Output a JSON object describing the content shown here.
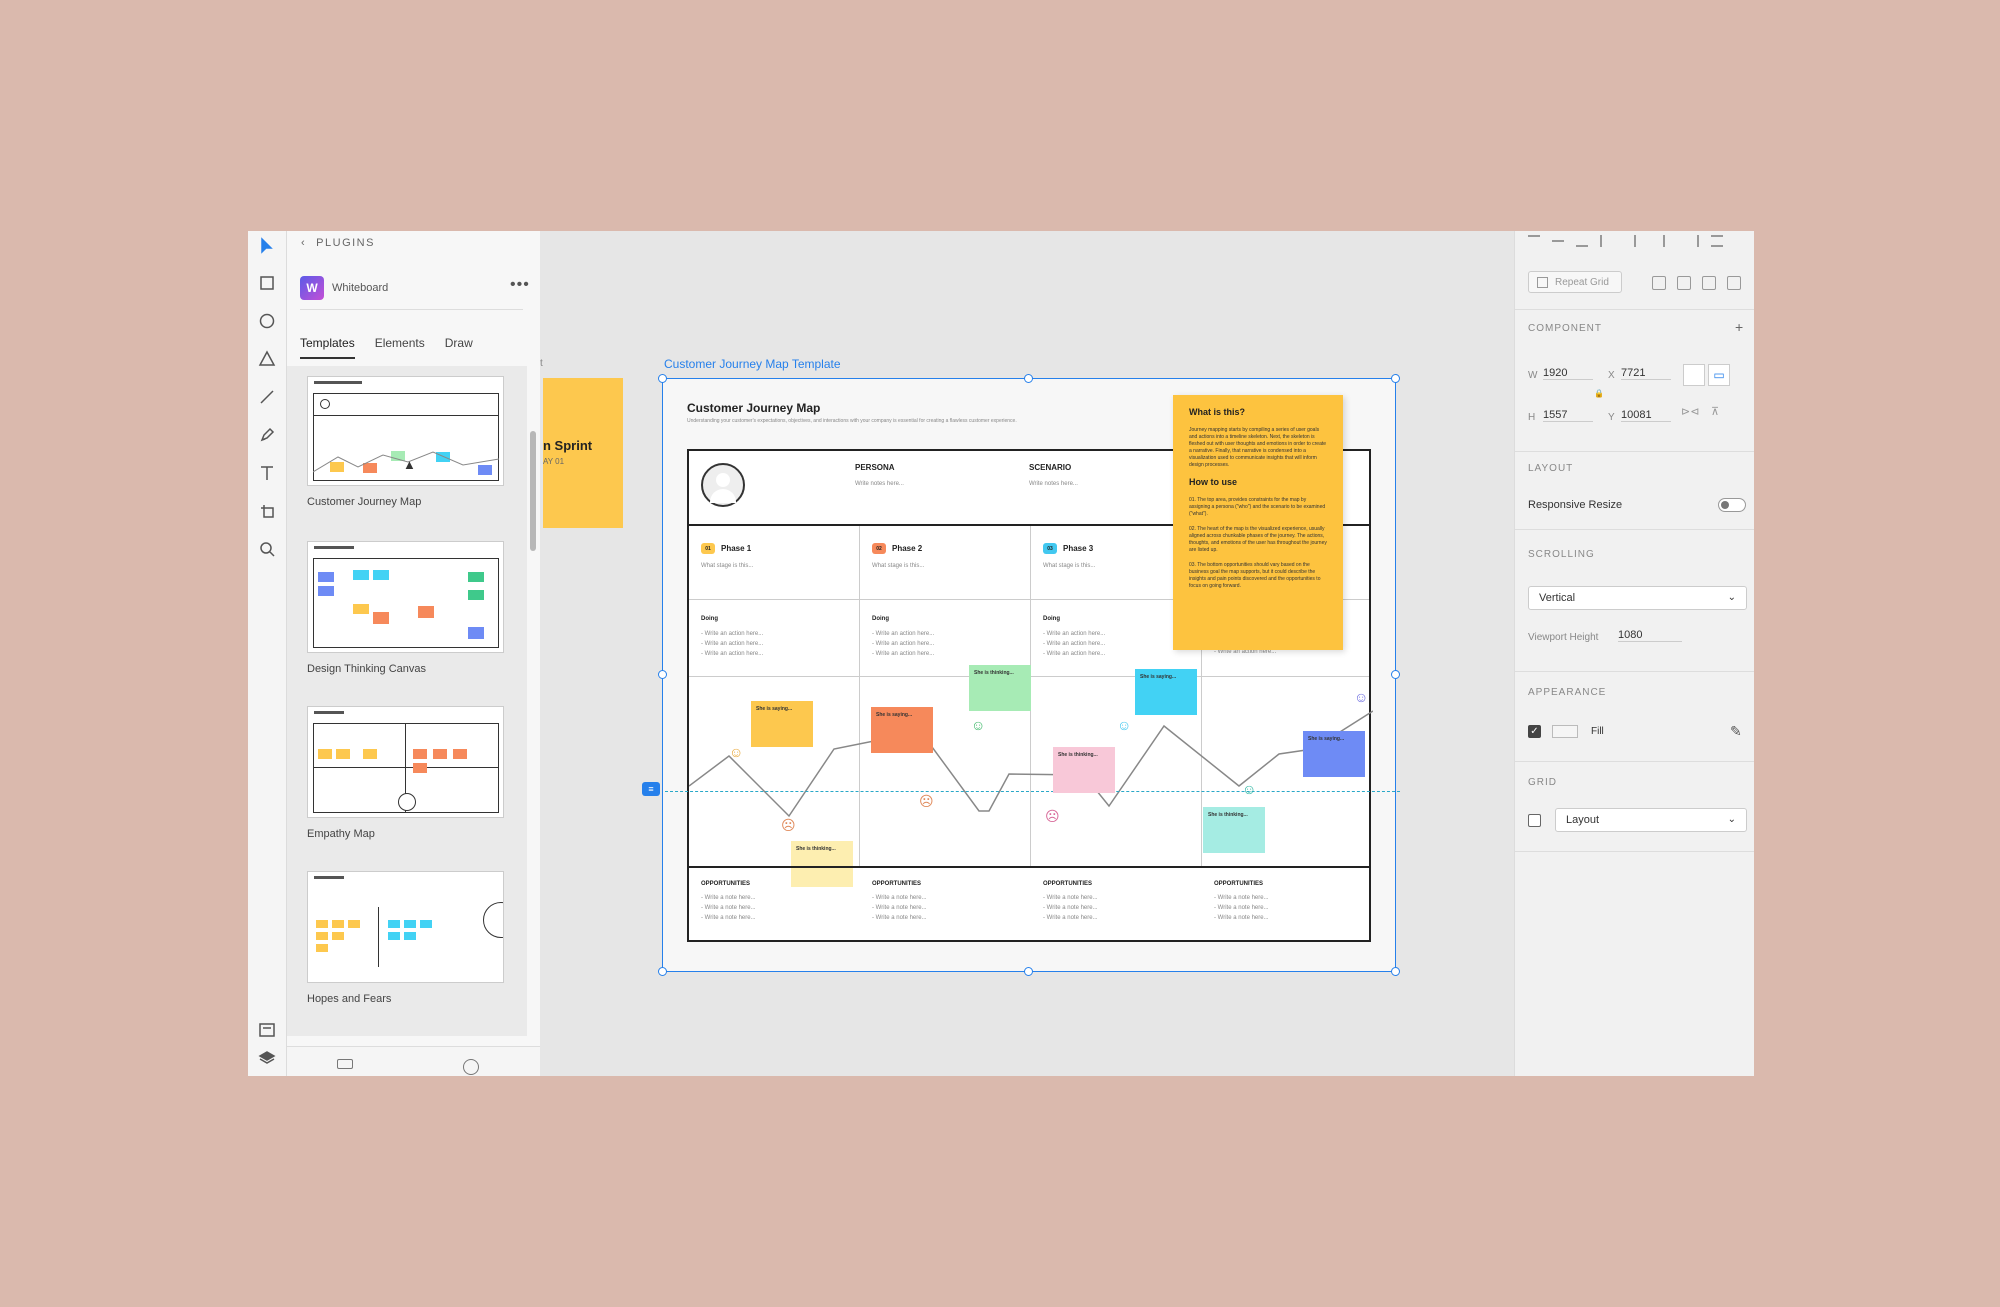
{
  "plugins": {
    "header": "PLUGINS",
    "plugin_name": "Whiteboard",
    "tabs": [
      "Templates",
      "Elements",
      "Draw"
    ],
    "templates": [
      "Customer Journey Map",
      "Design Thinking Canvas",
      "Empathy Map",
      "Hopes and Fears"
    ]
  },
  "canvas": {
    "artboard_label": "Customer Journey Map Template",
    "side_card_title": "n Sprint",
    "side_card_sub": "AY 01",
    "map": {
      "title": "Customer Journey Map",
      "subtitle": "Understanding your customer's expectations, objectives, and interactions with your company is essential for creating a flawless customer experience.",
      "persona_label": "PERSONA",
      "persona_note": "Write notes here...",
      "scenario_label": "SCENARIO",
      "scenario_note": "Write notes here...",
      "phases": [
        {
          "num": "01",
          "name": "Phase 1",
          "sub": "What stage is this...",
          "color": "#fdc84e"
        },
        {
          "num": "02",
          "name": "Phase 2",
          "sub": "What stage is this...",
          "color": "#f6895b"
        },
        {
          "num": "03",
          "name": "Phase 3",
          "sub": "What stage is this...",
          "color": "#42c8f0"
        }
      ],
      "doing_label": "Doing",
      "action_line": "- Write an action here...",
      "opportunities_label": "OPPORTUNITIES",
      "note_line": "- Write a note here...",
      "stickies": [
        {
          "text": "She is saying...",
          "color": "#fdc84e"
        },
        {
          "text": "She is thinking...",
          "color": "#fdeeb0"
        },
        {
          "text": "She is saying...",
          "color": "#f6895b"
        },
        {
          "text": "She is thinking...",
          "color": "#a7ebb5"
        },
        {
          "text": "She is thinking...",
          "color": "#f8c8d8"
        },
        {
          "text": "She is saying...",
          "color": "#42d2f4"
        },
        {
          "text": "She is thinking...",
          "color": "#a5ece3"
        },
        {
          "text": "She is saying...",
          "color": "#6e8bf5"
        }
      ],
      "info_card": {
        "title": "What is this?",
        "body": "Journey mapping starts by compiling a series of user goals and actions into a timeline skeleton. Next, the skeleton is fleshed out with user thoughts and emotions in order to create a narrative. Finally, that narrative is condensed into a visualization used to communicate insights that will inform design processes.",
        "how_title": "How to use",
        "steps": [
          "01. The top area, provides constraints for the map by assigning a persona (\"who\") and the scenario to be examined (\"what\").",
          "02. The heart of the map is the visualized experience, usually aligned across chunkable phases of the journey. The actions, thoughts, and emotions of the user has throughout the journey are listed up.",
          "03. The bottom opportunities should vary based on the business goal the map supports, but it could describe the insights and pain points discovered and the opportunities to focus on going forward."
        ]
      }
    }
  },
  "properties": {
    "repeat_grid": "Repeat Grid",
    "component_title": "COMPONENT",
    "w_label": "W",
    "w_value": "1920",
    "x_label": "X",
    "x_value": "7721",
    "h_label": "H",
    "h_value": "1557",
    "y_label": "Y",
    "y_value": "10081",
    "layout_title": "LAYOUT",
    "responsive_resize": "Responsive Resize",
    "scrolling_title": "SCROLLING",
    "scrolling_value": "Vertical",
    "viewport_label": "Viewport Height",
    "viewport_value": "1080",
    "appearance_title": "APPEARANCE",
    "fill_label": "Fill",
    "fill_checked": true,
    "grid_title": "GRID",
    "grid_value": "Layout",
    "grid_checked": false
  }
}
